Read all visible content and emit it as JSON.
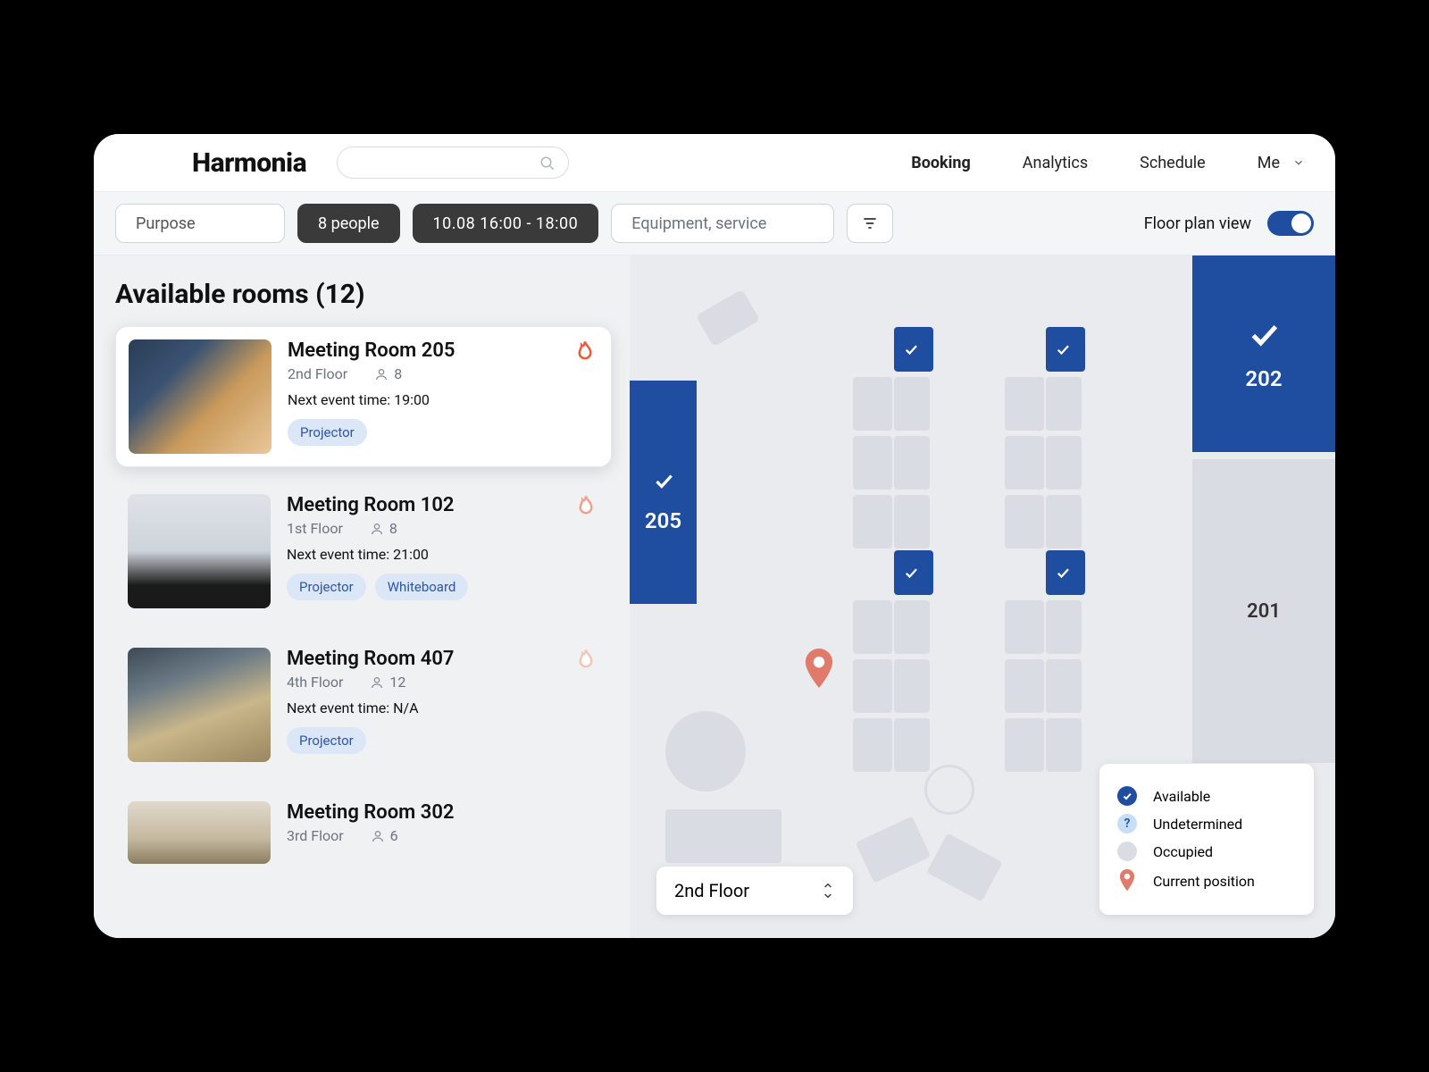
{
  "brand": "Harmonia",
  "nav": {
    "booking": "Booking",
    "analytics": "Analytics",
    "schedule": "Schedule",
    "me": "Me"
  },
  "filters": {
    "purpose": "Purpose",
    "people": "8 people",
    "datetime": "10.08   16:00 - 18:00",
    "equipment_placeholder": "Equipment, service",
    "floorplan_label": "Floor plan view"
  },
  "list": {
    "title": "Available rooms (12)",
    "rooms": [
      {
        "name": "Meeting Room 205",
        "floor": "2nd Floor",
        "capacity": "8",
        "next": "Next event time: 19:00",
        "tags": [
          "Projector"
        ]
      },
      {
        "name": "Meeting Room 102",
        "floor": "1st Floor",
        "capacity": "8",
        "next": "Next event time: 21:00",
        "tags": [
          "Projector",
          "Whiteboard"
        ]
      },
      {
        "name": "Meeting Room 407",
        "floor": "4th Floor",
        "capacity": "12",
        "next": "Next event time: N/A",
        "tags": [
          "Projector"
        ]
      },
      {
        "name": "Meeting Room 302",
        "floor": "3rd Floor",
        "capacity": "6",
        "next": "",
        "tags": []
      }
    ]
  },
  "floorplan": {
    "rooms": {
      "r205": "205",
      "r202": "202",
      "r201": "201"
    },
    "floor_selector": "2nd Floor"
  },
  "legend": {
    "available": "Available",
    "undetermined": "Undetermined",
    "occupied": "Occupied",
    "current": "Current position"
  }
}
